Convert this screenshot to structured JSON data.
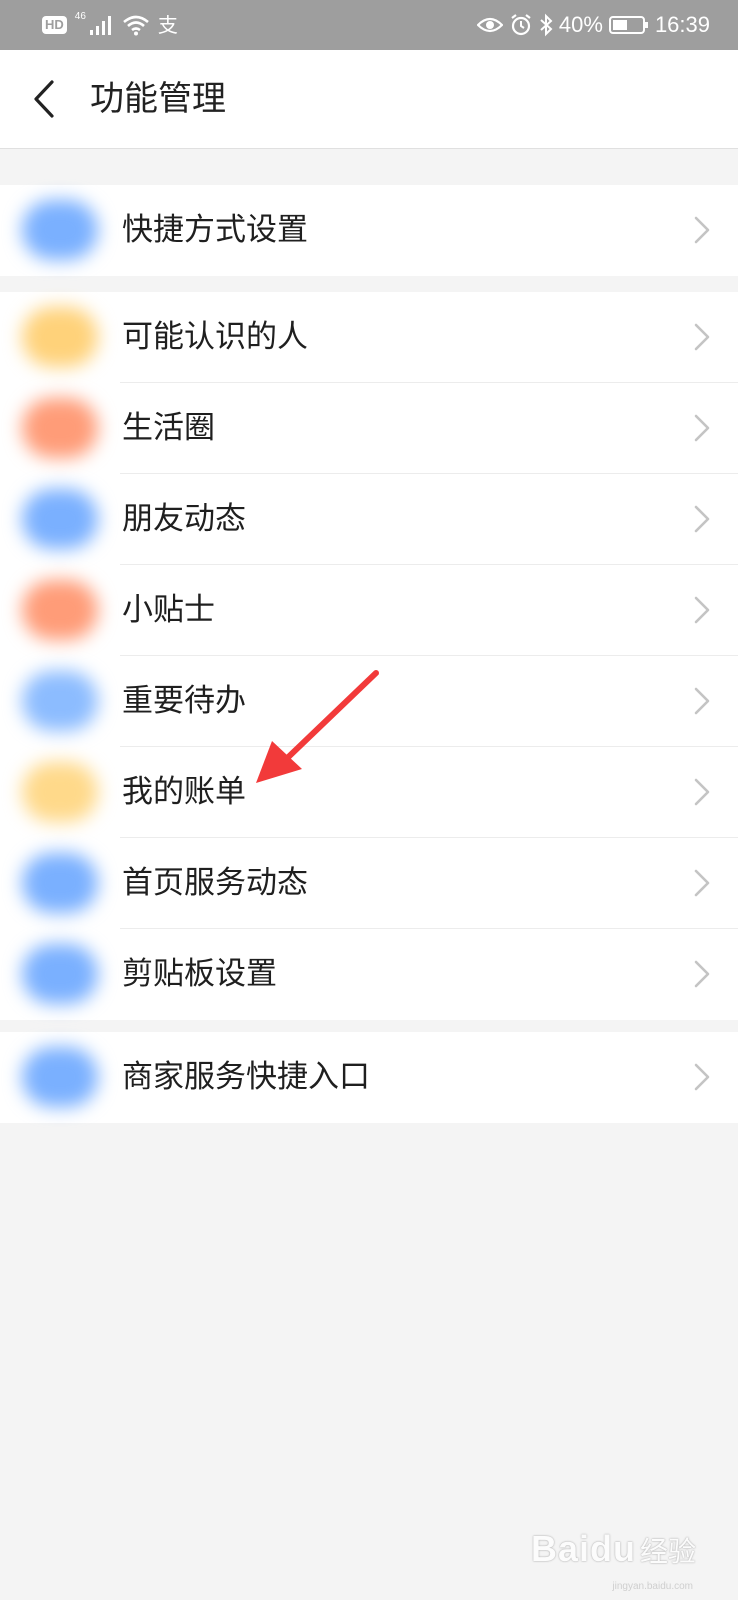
{
  "status_bar": {
    "hd_badge": "HD",
    "network_type": "46",
    "alipay_glyph": "支",
    "battery_text": "40%",
    "time": "16:39",
    "icons": [
      "signal-icon",
      "wifi-icon",
      "eye-icon",
      "alarm-icon",
      "bluetooth-icon",
      "battery-icon"
    ]
  },
  "header": {
    "title": "功能管理"
  },
  "groups": [
    {
      "items": [
        {
          "label": "快捷方式设置",
          "icon_color": "#7ab0ff"
        }
      ]
    },
    {
      "items": [
        {
          "label": "可能认识的人",
          "icon_color": "#ffd27a"
        },
        {
          "label": "生活圈",
          "icon_color": "#ff9c78"
        },
        {
          "label": "朋友动态",
          "icon_color": "#7ab0ff"
        },
        {
          "label": "小贴士",
          "icon_color": "#ff9c78"
        },
        {
          "label": "重要待办",
          "icon_color": "#8cbcff"
        },
        {
          "label": "我的账单",
          "icon_color": "#ffd98a"
        },
        {
          "label": "首页服务动态",
          "icon_color": "#7ab0ff"
        },
        {
          "label": "剪贴板设置",
          "icon_color": "#7ab0ff"
        }
      ]
    },
    {
      "items": [
        {
          "label": "商家服务快捷入口",
          "icon_color": "#7ab0ff"
        }
      ]
    }
  ],
  "watermark": {
    "logo": "Baidu",
    "sub": "经验",
    "url": "jingyan.baidu.com"
  },
  "colors": {
    "background": "#f4f4f4",
    "status_bar": "#9e9e9e",
    "arrow": "#f23a3a",
    "chevron": "#c4c4c4"
  }
}
